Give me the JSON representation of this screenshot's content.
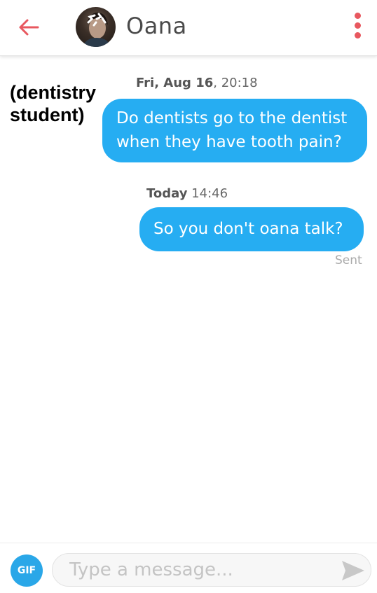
{
  "header": {
    "back_icon": "arrow-left-icon",
    "contact_name": "Oana",
    "menu_icon": "vertical-dots-icon",
    "accent_color": "#e8585f"
  },
  "overlay_caption": "(dentistry\nstudent)",
  "messages": [
    {
      "timestamp_day": "Fri, Aug 16",
      "timestamp_time": ", 20:18",
      "text": "Do dentists go to the dentist when they have tooth pain?"
    },
    {
      "timestamp_day": "Today",
      "timestamp_time": " 14:46",
      "text": "So you don't oana talk?",
      "status": "Sent"
    }
  ],
  "bubble_color": "#26adf2",
  "composer": {
    "gif_label": "GIF",
    "placeholder": "Type a message...",
    "send_icon": "send-icon"
  }
}
